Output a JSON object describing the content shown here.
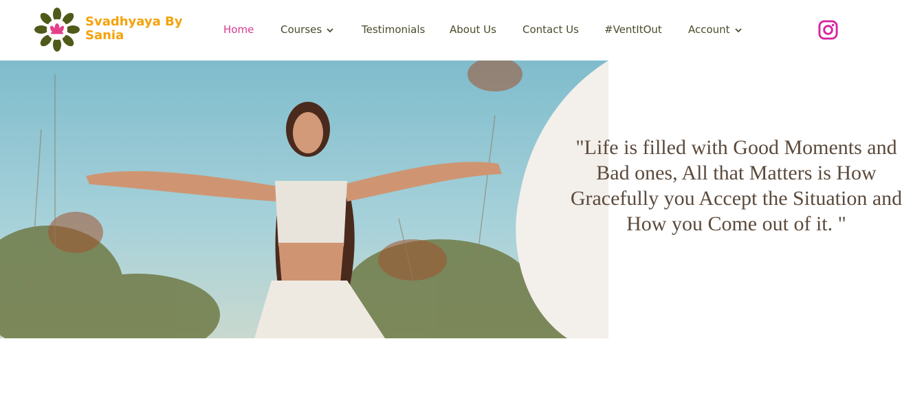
{
  "brand": {
    "name": "Svadhyaya By Sania",
    "logo_icon": "lotus-mandala-icon"
  },
  "nav": {
    "items": [
      {
        "label": "Home",
        "active": true
      },
      {
        "label": "Courses",
        "dropdown": true
      },
      {
        "label": "Testimonials"
      },
      {
        "label": "About Us"
      },
      {
        "label": "Contact Us"
      },
      {
        "label": "#VentItOut"
      },
      {
        "label": "Account",
        "dropdown": true
      }
    ]
  },
  "social": {
    "icon": "instagram-icon",
    "color": "#d6249f"
  },
  "hero": {
    "quote": "\"Life is filled with Good Moments and Bad ones,  All that Matters is How Gracefully you Accept the Situation and How you Come out of it. \""
  },
  "colors": {
    "brand": "#f4a20a",
    "nav_active": "#d63a8d",
    "nav_text": "#4a4a2c",
    "quote_text": "#5b4a3c"
  }
}
